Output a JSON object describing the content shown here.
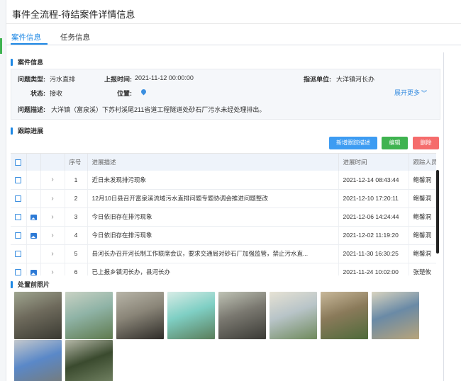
{
  "window": {
    "title": "事件全流程-待结案件详情信息"
  },
  "tabs": [
    {
      "label": "案件信息",
      "active": true
    },
    {
      "label": "任务信息",
      "active": false
    }
  ],
  "case_info": {
    "header": "案件信息",
    "problem_type_label": "问题类型:",
    "problem_type_value": "污水直排",
    "report_time_label": "上报时间:",
    "report_time_value": "2021-11-12 00:00:00",
    "dispatch_unit_label": "指派单位:",
    "dispatch_unit_value": "大洋镇河长办",
    "status_label": "状态:",
    "status_value": "接收",
    "location_label": "位置:",
    "expand_label": "展开更多",
    "description_label": "问题描述:",
    "description_value": "大洋镇（富泉溪）下苏村溪尾211省道工程隧道处砂石厂污水未经处理排出。"
  },
  "tracking": {
    "header": "跟踪进展",
    "buttons": {
      "add": "新增跟踪描述",
      "edit": "编辑",
      "delete": "删除"
    },
    "columns": [
      "序号",
      "进展描述",
      "进展时间",
      "跟踪人员"
    ],
    "rows": [
      {
        "no": "1",
        "desc": "近日未发现排污现象",
        "time": "2021-12-14 08:43:44",
        "person": "鲍馨洞",
        "has_image": false
      },
      {
        "no": "2",
        "desc": "12月10日县召开富泉溪流域污水直排问题专题协调会推进问题整改",
        "time": "2021-12-10 17:20:11",
        "person": "鲍馨洞",
        "has_image": false
      },
      {
        "no": "3",
        "desc": "今日依旧存在排污现象",
        "time": "2021-12-06 14:24:44",
        "person": "鲍馨洞",
        "has_image": true
      },
      {
        "no": "4",
        "desc": "今日依旧存在排污现象",
        "time": "2021-12-02 11:19:20",
        "person": "鲍馨洞",
        "has_image": true
      },
      {
        "no": "5",
        "desc": "县河长办召开河长制工作联席会议，要求交通局对砂石厂加强监管，禁止污水直...",
        "time": "2021-11-30 16:30:25",
        "person": "鲍馨洞",
        "has_image": false
      },
      {
        "no": "6",
        "desc": "已上报乡镇河长办，县河长办",
        "time": "2021-11-24 10:02:00",
        "person": "张楚攸",
        "has_image": true
      }
    ]
  },
  "photos": {
    "header": "处置前照片",
    "items": [
      {
        "name": "tunnel-stream",
        "colors": [
          "#6e6a5c",
          "#3a3a32",
          "#9fa58f"
        ]
      },
      {
        "name": "rocky-stream",
        "colors": [
          "#8fb3a6",
          "#5f7a4e",
          "#c9d2c4"
        ]
      },
      {
        "name": "tunnel-entrance",
        "colors": [
          "#8a8578",
          "#2e2c28",
          "#b8b5a8"
        ]
      },
      {
        "name": "turquoise-water",
        "colors": [
          "#7fcfc4",
          "#5a7d5a",
          "#d8ece6"
        ]
      },
      {
        "name": "tunnel-river",
        "colors": [
          "#7a7870",
          "#3a3a35",
          "#bfc3b5"
        ]
      },
      {
        "name": "quarry-site",
        "colors": [
          "#b8c4c8",
          "#6f8a5c",
          "#e6e2d4"
        ]
      },
      {
        "name": "valley-river",
        "colors": [
          "#8a7a5a",
          "#4e6a3a",
          "#c8b89a"
        ]
      },
      {
        "name": "muddy-pond",
        "colors": [
          "#6a8aa6",
          "#b8a47a",
          "#d9d4c0"
        ]
      },
      {
        "name": "discharge-pipe",
        "colors": [
          "#5a88c8",
          "#7a7a70",
          "#c4c8cc"
        ]
      },
      {
        "name": "overgrown-bank",
        "colors": [
          "#3a4a2e",
          "#7a8a6a",
          "#b5b8a8"
        ]
      }
    ]
  }
}
